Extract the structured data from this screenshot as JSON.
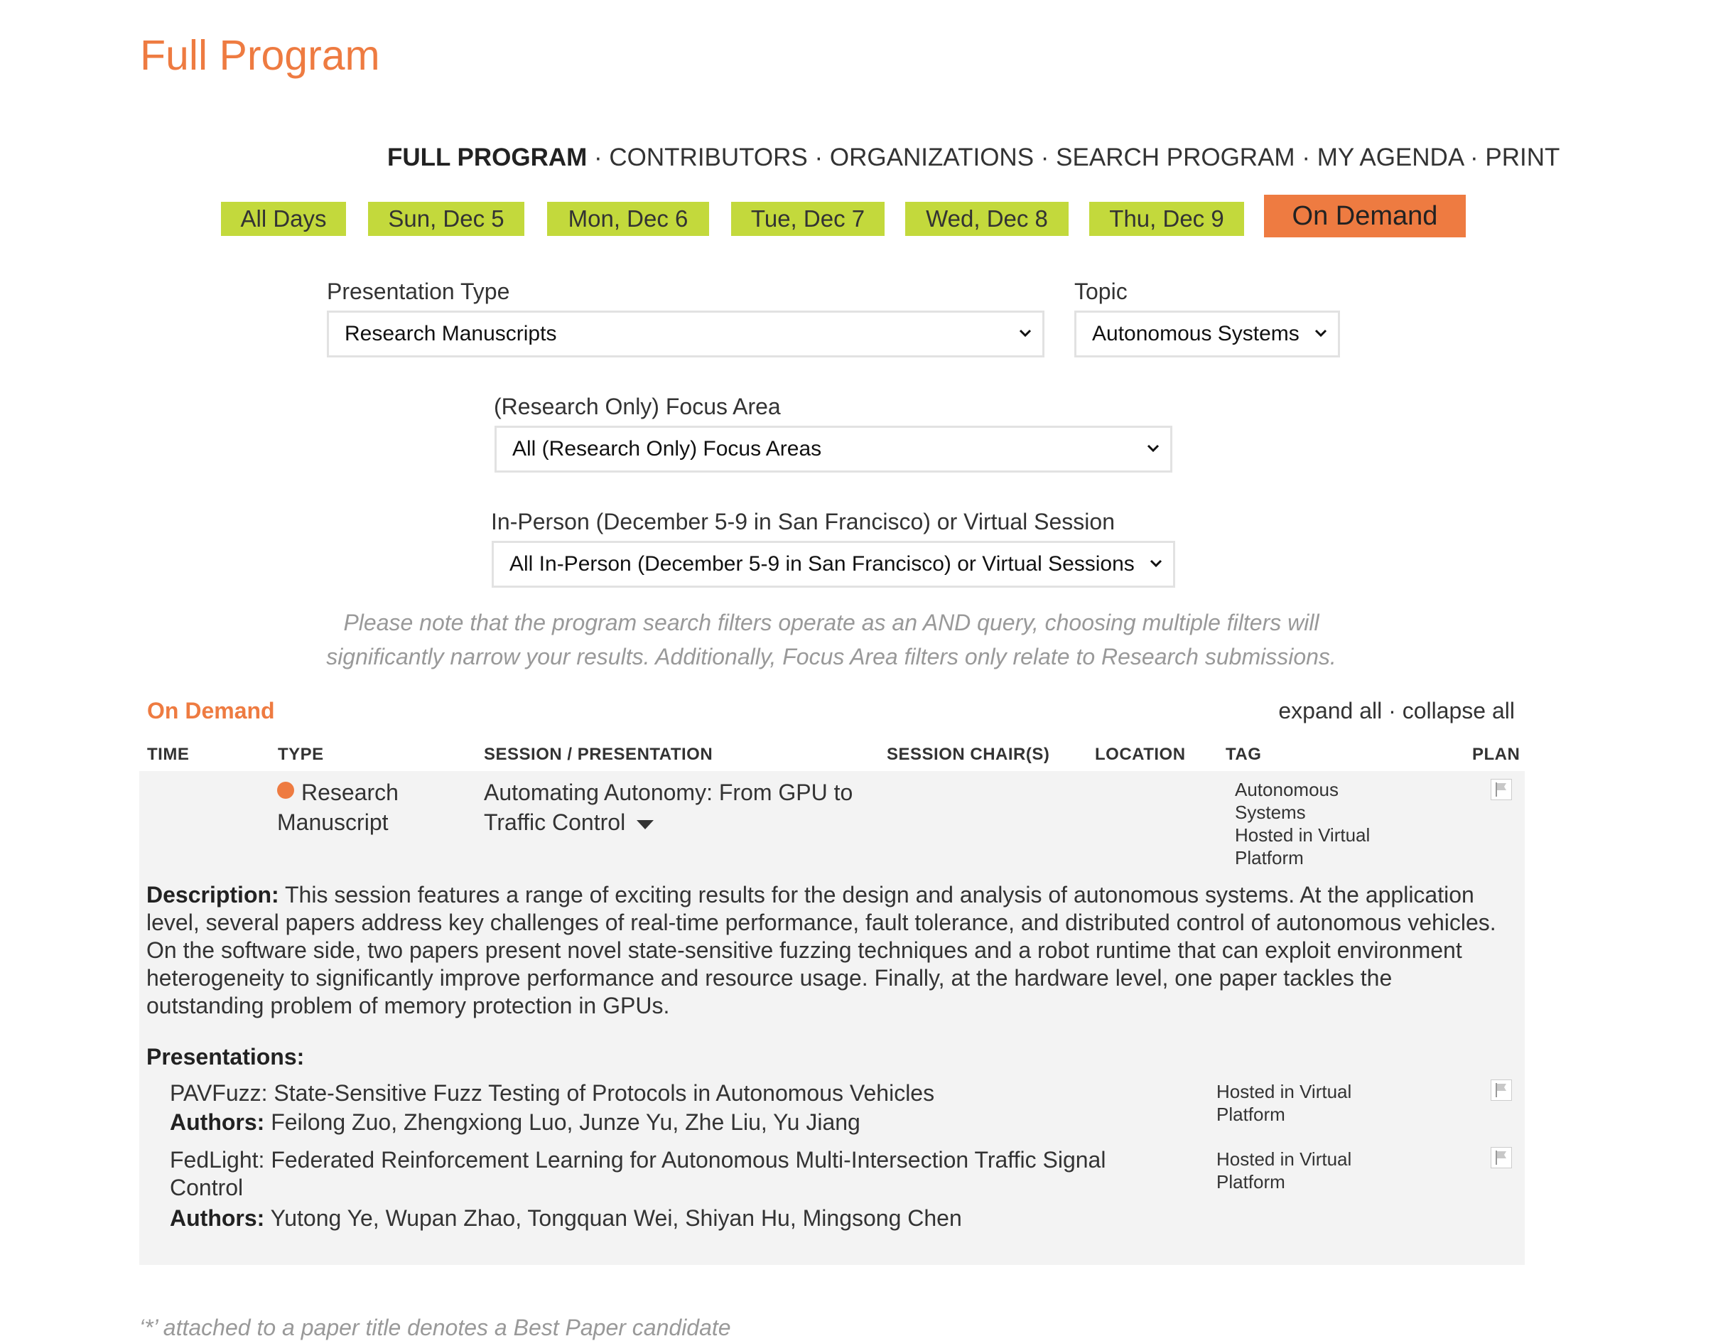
{
  "page": {
    "title": "Full Program"
  },
  "topnav": {
    "items": [
      {
        "label": "FULL PROGRAM"
      },
      {
        "label": "CONTRIBUTORS"
      },
      {
        "label": "ORGANIZATIONS"
      },
      {
        "label": "SEARCH PROGRAM"
      },
      {
        "label": "MY AGENDA"
      },
      {
        "label": "PRINT"
      }
    ],
    "separator": " · "
  },
  "days": {
    "items": [
      "All Days",
      "Sun, Dec 5",
      "Mon, Dec 6",
      "Tue, Dec 7",
      "Wed, Dec 8",
      "Thu, Dec 9"
    ],
    "active": "On Demand"
  },
  "colors": {
    "accent": "#ee7b41",
    "day_button": "#c3d93c",
    "panel": "#f3f3f3"
  },
  "filters": {
    "presentation_type": {
      "label": "Presentation Type",
      "value": "Research Manuscripts"
    },
    "topic": {
      "label": "Topic",
      "value": "Autonomous Systems"
    },
    "focus_area": {
      "label": "(Research Only) Focus Area",
      "value": "All (Research Only) Focus Areas"
    },
    "session_mode": {
      "label": "In-Person (December 5-9 in San Francisco) or Virtual Session",
      "value": "All In-Person (December 5-9 in San Francisco) or Virtual Sessions"
    },
    "note_line1": "Please note that the program search filters operate as an AND query, choosing multiple filters will",
    "note_line2": "significantly narrow your results. Additionally, Focus Area filters only relate to Research submissions."
  },
  "listing": {
    "heading": "On Demand",
    "expand_all": "expand all",
    "collapse_all": "collapse all",
    "separator": " · ",
    "columns": [
      "TIME",
      "TYPE",
      "SESSION / PRESENTATION",
      "SESSION CHAIR(S)",
      "LOCATION",
      "TAG",
      "PLAN"
    ]
  },
  "session": {
    "type_line1": "Research",
    "type_line2": "Manuscript",
    "title_line1": "Automating Autonomy: From GPU to",
    "title_line2": "Traffic Control",
    "tags": [
      "Autonomous",
      "Systems",
      "Hosted in Virtual",
      "Platform"
    ],
    "description_label": "Description:",
    "description_lines": [
      "This session features a range of exciting results for the design and analysis of autonomous systems. At the application",
      "level, several papers address key challenges of real-time performance, fault tolerance, and distributed control of autonomous vehicles.",
      "On the software side, two papers present novel state-sensitive fuzzing techniques and a robot runtime that can exploit environment",
      "heterogeneity to significantly improve performance and resource usage. Finally, at the hardware level, one paper tackles the",
      "outstanding problem of memory protection in GPUs."
    ],
    "presentations_label": "Presentations:",
    "authors_label": "Authors:",
    "presentations": [
      {
        "title_lines": [
          "PAVFuzz: State-Sensitive Fuzz Testing of Protocols in Autonomous Vehicles"
        ],
        "authors": "Feilong Zuo, Zhengxiong Luo, Junze Yu, Zhe Liu, Yu Jiang",
        "tag_lines": [
          "Hosted in Virtual",
          "Platform"
        ]
      },
      {
        "title_lines": [
          "FedLight: Federated Reinforcement Learning for Autonomous Multi-Intersection Traffic Signal",
          "Control"
        ],
        "authors": "Yutong Ye, Wupan Zhao, Tongquan Wei, Shiyan Hu, Mingsong Chen",
        "tag_lines": [
          "Hosted in Virtual",
          "Platform"
        ]
      }
    ]
  },
  "footnote": "‘*’ attached to a paper title denotes a Best Paper candidate"
}
